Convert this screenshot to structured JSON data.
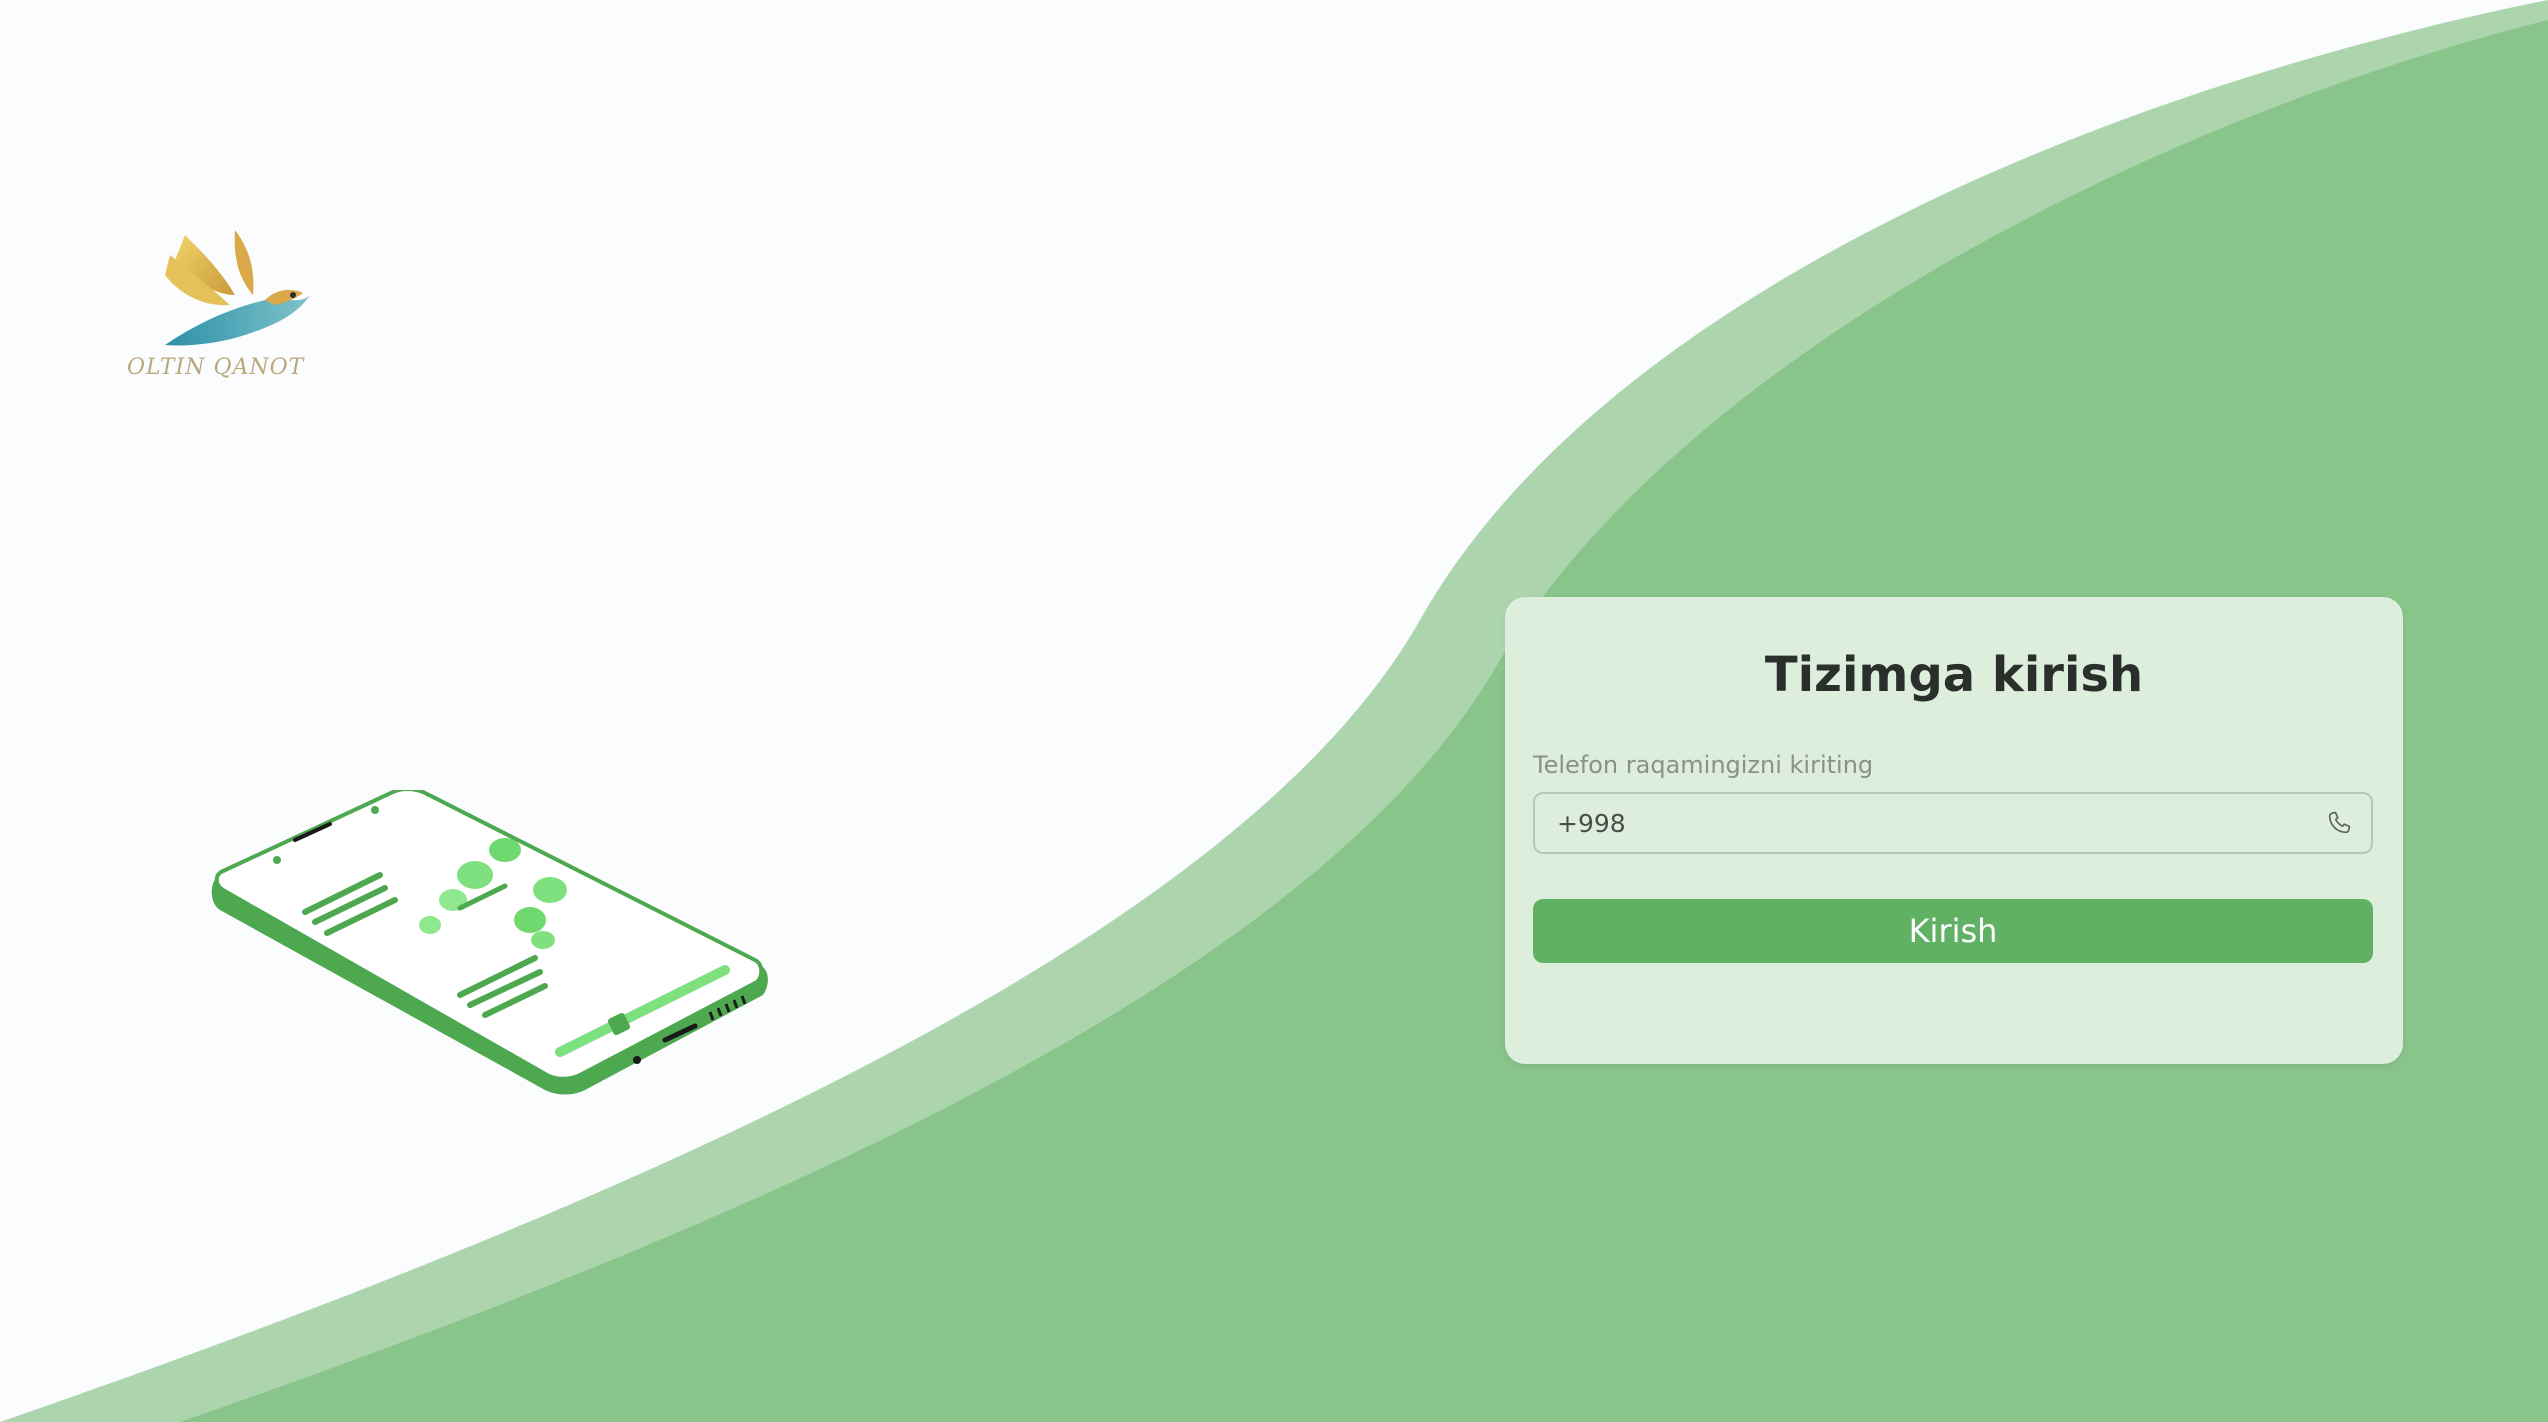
{
  "brand": {
    "logo_text": "OLTIN QANOT"
  },
  "login": {
    "title": "Tizimga kirish",
    "phone_label": "Telefon raqamingizni kiriting",
    "phone_value": "+998",
    "submit_label": "Kirish"
  },
  "icons": {
    "logo": "bird-logo-icon",
    "illustration": "isometric-phone-illustration",
    "phone_field": "phone-icon"
  },
  "colors": {
    "background": "#fbfcfd",
    "wave_light": "#acd5ae",
    "wave_main": "#89c58b",
    "card": "#ddeedd",
    "button": "#61b164",
    "title_text": "#2b2f2c"
  }
}
